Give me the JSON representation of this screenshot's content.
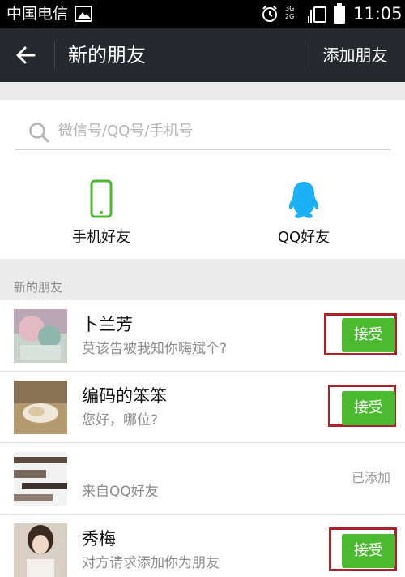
{
  "status_bar": {
    "carrier": "中国电信",
    "net_top": "3G",
    "net_bottom": "2G",
    "time": "11:05"
  },
  "header": {
    "title": "新的朋友",
    "add_friend_label": "添加朋友"
  },
  "search": {
    "placeholder": "微信号/QQ号/手机号"
  },
  "quick_add": [
    {
      "label": "手机好友",
      "icon": "phone-icon"
    },
    {
      "label": "QQ好友",
      "icon": "qq-penguin-icon"
    }
  ],
  "section_title": "新的朋友",
  "requests": [
    {
      "name": "卜兰芳",
      "message": "莫该告被我知你嗨斌个?",
      "action": "接受",
      "state": "pending"
    },
    {
      "name": "编码的笨笨",
      "message": "您好，哪位?",
      "action": "接受",
      "state": "pending"
    },
    {
      "name": "",
      "message": "来自QQ好友",
      "action": "已添加",
      "state": "added"
    },
    {
      "name": "秀梅",
      "message": "对方请求添加你为朋友",
      "action": "接受",
      "state": "pending"
    }
  ],
  "colors": {
    "header_bg": "#262a2e",
    "accept_green": "#4cba30",
    "highlight_red": "#a9232b",
    "page_bg": "#ebebeb"
  }
}
